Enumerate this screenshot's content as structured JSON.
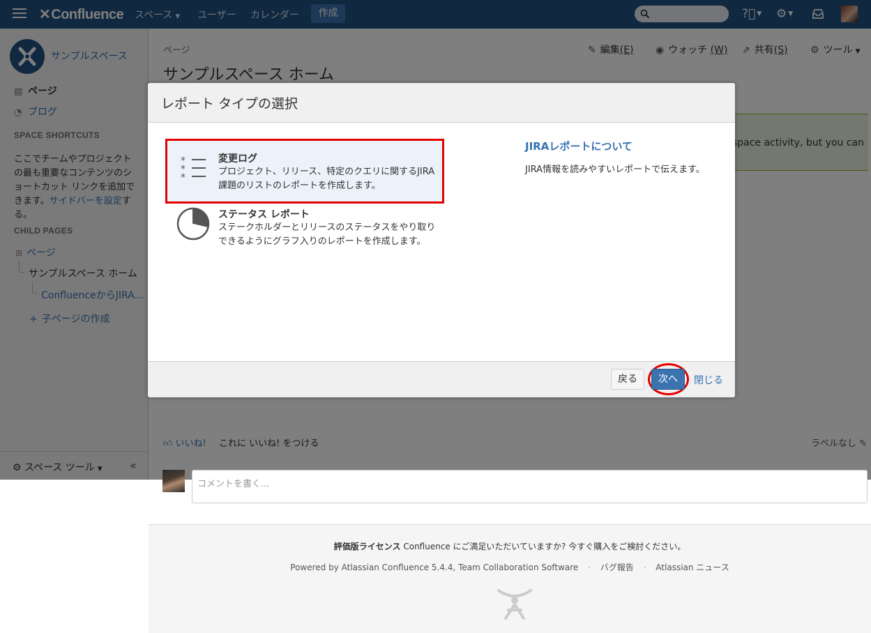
{
  "topnav": {
    "logo": "Confluence",
    "menu_spaces": "スペース",
    "menu_users": "ユーザー",
    "menu_calendar": "カレンダー",
    "create_label": "作成",
    "search_placeholder": ""
  },
  "sidebar": {
    "space_name": "サンプルスペース",
    "link_pages": "ページ",
    "link_blog": "ブログ",
    "shortcuts_heading": "SPACE SHORTCUTS",
    "shortcuts_text_pre": "ここでチームやプロジェクトの最も重要なコンテンツのショートカット リンクを追加できます。",
    "shortcuts_link": "サイドバーを設定",
    "shortcuts_text_post": "する。",
    "child_heading": "CHILD PAGES",
    "tree_root": "ページ",
    "tree_home": "サンプルスペース ホーム",
    "tree_child": "ConfluenceからJIRA...",
    "add_child": "子ページの作成",
    "space_tools": "スペース ツール"
  },
  "main": {
    "breadcrumb": "ページ",
    "title": "サンプルスペース ホーム",
    "action_edit": "編集",
    "action_edit_key": "(E)",
    "action_watch": "ウォッチ",
    "action_watch_key": "(W)",
    "action_share": "共有",
    "action_share_key": "(S)",
    "action_tools": "ツール",
    "info_text": "t space activity, but you can",
    "like_label": "いいね!",
    "like_text": "これに いいね! をつける",
    "no_labels": "ラベルなし"
  },
  "dialog": {
    "title": "レポート タイプの選択",
    "report_types": [
      {
        "name": "変更ログ",
        "desc": "プロジェクト、リリース、特定のクエリに関するJIRA課題のリストのレポートを作成します。",
        "selected": true
      },
      {
        "name": "ステータス レポート",
        "desc": "ステークホルダーとリリースのステータスをやり取りできるようにグラフ入りのレポートを作成します。",
        "selected": false
      }
    ],
    "about_title": "JIRAレポートについて",
    "about_text": "JIRA情報を読みやすいレポートで伝えます。",
    "back_label": "戻る",
    "next_label": "次へ",
    "close_label": "閉じる"
  },
  "comment": {
    "placeholder": "コメントを書く..."
  },
  "footer": {
    "license_bold": "評価版ライセンス",
    "license_text": " Confluence にご満足いただいていますか? 今すぐ購入をご検討ください。",
    "powered": "Powered by Atlassian Confluence 5.4.4, Team Collaboration Software",
    "bug_report": "バグ報告",
    "news": "Atlassian ニュース"
  },
  "colors": {
    "nav_bg": "#205081",
    "accent": "#3b73af",
    "highlight": "#e40000"
  }
}
